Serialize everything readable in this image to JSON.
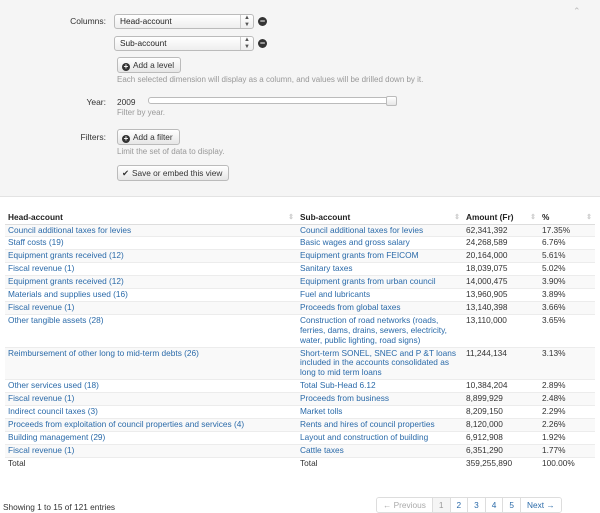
{
  "filters_panel": {
    "columns_label": "Columns:",
    "column_levels": [
      "Head-account",
      "Sub-account"
    ],
    "add_level_label": "Add a level",
    "columns_help": "Each selected dimension will display as a column, and values will be drilled down by it.",
    "year_label": "Year:",
    "year_value": "2009",
    "year_help": "Filter by year.",
    "filters_label": "Filters:",
    "add_filter_label": "Add a filter",
    "filters_help": "Limit the set of data to display.",
    "save_embed_label": "Save or embed this view"
  },
  "table": {
    "headers": [
      "Head-account",
      "Sub-account",
      "Amount (Fr)",
      "%"
    ],
    "rows": [
      {
        "head": "Council additional taxes for levies",
        "sub": "Council additional taxes for levies",
        "amount": "62,341,392",
        "pct": "17.35%"
      },
      {
        "head": "Staff costs (19)",
        "sub": "Basic wages and gross salary",
        "amount": "24,268,589",
        "pct": "6.76%"
      },
      {
        "head": "Equipment grants received (12)",
        "sub": "Equipment grants from FEICOM",
        "amount": "20,164,000",
        "pct": "5.61%"
      },
      {
        "head": "Fiscal revenue (1)",
        "sub": "Sanitary taxes",
        "amount": "18,039,075",
        "pct": "5.02%"
      },
      {
        "head": "Equipment grants received (12)",
        "sub": "Equipment grants from urban council",
        "amount": "14,000,475",
        "pct": "3.90%"
      },
      {
        "head": "Materials and supplies used (16)",
        "sub": "Fuel and lubricants",
        "amount": "13,960,905",
        "pct": "3.89%"
      },
      {
        "head": "Fiscal revenue (1)",
        "sub": "Proceeds from global taxes",
        "amount": "13,140,398",
        "pct": "3.66%"
      },
      {
        "head": "Other tangible assets (28)",
        "sub": "Construction of road networks (roads, ferries, dams, drains, sewers, electricity, water, public lighting, road signs)",
        "amount": "13,110,000",
        "pct": "3.65%"
      },
      {
        "head": "Reimbursement of other long to mid-term debts (26)",
        "sub": "Short-term SONEL, SNEC and P &T loans included in the accounts consolidated as long to mid term loans",
        "amount": "11,244,134",
        "pct": "3.13%"
      },
      {
        "head": "Other services used (18)",
        "sub": "Total Sub-Head 6.12",
        "amount": "10,384,204",
        "pct": "2.89%"
      },
      {
        "head": "Fiscal revenue (1)",
        "sub": "Proceeds from business",
        "amount": "8,899,929",
        "pct": "2.48%"
      },
      {
        "head": "Indirect council taxes (3)",
        "sub": "Market tolls",
        "amount": "8,209,150",
        "pct": "2.29%"
      },
      {
        "head": "Proceeds from exploitation of council properties and services (4)",
        "sub": "Rents and hires of council properties",
        "amount": "8,120,000",
        "pct": "2.26%"
      },
      {
        "head": "Building management (29)",
        "sub": "Layout and construction of building",
        "amount": "6,912,908",
        "pct": "1.92%"
      },
      {
        "head": "Fiscal revenue (1)",
        "sub": "Cattle taxes",
        "amount": "6,351,290",
        "pct": "1.77%"
      }
    ],
    "total": {
      "head": "Total",
      "sub": "Total",
      "amount": "359,255,890",
      "pct": "100.00%"
    }
  },
  "footer": {
    "info": "Showing 1 to 15 of 121 entries",
    "pager": {
      "previous": "← Previous",
      "pages": [
        "1",
        "2",
        "3",
        "4",
        "5"
      ],
      "next": "Next →",
      "active_page": "1"
    }
  },
  "colors": {
    "link": "#2a6aa9",
    "panel_bg": "#f5f5f5"
  }
}
